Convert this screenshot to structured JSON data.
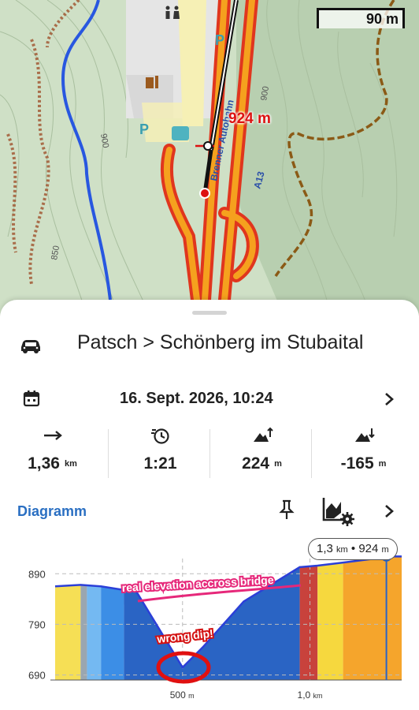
{
  "map": {
    "scale_label": "90 m",
    "distance_label": "924 m",
    "road_label": "Brenner Autobahn",
    "highway_label": "A13",
    "contour_labels": [
      "900",
      "900",
      "850"
    ],
    "parking_labels": [
      "P",
      "P"
    ]
  },
  "route": {
    "title": "Patsch > Schönberg im Stubaital",
    "datetime": "16. Sept. 2026, 10:24"
  },
  "stats": [
    {
      "icon": "distance-icon",
      "value": "1,36",
      "unit": "km"
    },
    {
      "icon": "duration-icon",
      "value": "1:21",
      "unit": ""
    },
    {
      "icon": "ascent-icon",
      "value": "224",
      "unit": "m"
    },
    {
      "icon": "descent-icon",
      "value": "-165",
      "unit": "m"
    }
  ],
  "diagram": {
    "label": "Diagramm",
    "tooltip_distance": "1,3",
    "tooltip_distance_unit": "km",
    "tooltip_sep": "•",
    "tooltip_elevation": "924",
    "tooltip_elevation_unit": "m"
  },
  "annotations": {
    "bridge": "real elevation accross bridge",
    "dip": "wrong dip!"
  },
  "chart_data": {
    "type": "area",
    "title": "",
    "xlabel": "",
    "ylabel": "",
    "yticks": [
      "890",
      "790",
      "690"
    ],
    "xticks": [
      {
        "value": 0.5,
        "label": "500",
        "unit": "m"
      },
      {
        "value": 1.0,
        "label": "1,0",
        "unit": "km"
      }
    ],
    "xlim": [
      0,
      1.36
    ],
    "ylim": [
      680,
      920
    ],
    "x": [
      0.0,
      0.1,
      0.18,
      0.27,
      0.31,
      0.5,
      0.58,
      0.66,
      0.74,
      0.96,
      1.03,
      1.13,
      1.32,
      1.36
    ],
    "y": [
      865,
      868,
      865,
      858,
      862,
      705,
      745,
      790,
      835,
      903,
      906,
      912,
      924,
      924
    ],
    "segments": [
      {
        "to": 0.1,
        "color": "#f6df55"
      },
      {
        "to": 0.125,
        "color": "#9aa6b0"
      },
      {
        "to": 0.18,
        "color": "#74b9f2"
      },
      {
        "to": 0.27,
        "color": "#3c8ee6"
      },
      {
        "to": 0.96,
        "color": "#2a64c4"
      },
      {
        "to": 1.03,
        "color": "#c8423c"
      },
      {
        "to": 1.13,
        "color": "#f6d83e"
      },
      {
        "to": 1.36,
        "color": "#f5a52c"
      }
    ],
    "line_color": "#2b3fd8",
    "cursor_x": 1.3,
    "cursor_y": 924,
    "grid": true
  }
}
